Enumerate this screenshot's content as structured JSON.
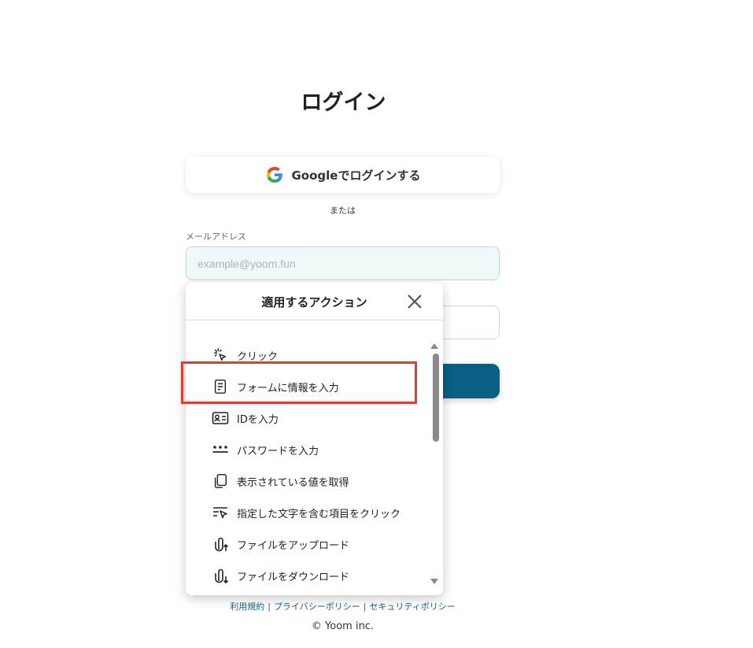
{
  "page": {
    "title": "ログイン",
    "google_button_label": "Googleでログインする",
    "or_text": "または",
    "email_label": "メールアドレス",
    "email_placeholder": "example@yoom.fun",
    "footer": {
      "terms": "利用規約",
      "privacy": "プライバシーポリシー",
      "security": "セキュリティポリシー",
      "separator": "|"
    },
    "copyright": "© Yoom inc."
  },
  "action_panel": {
    "title": "適用するアクション",
    "items": [
      {
        "label": "クリック",
        "icon": "click-cursor-icon"
      },
      {
        "label": "フォームに情報を入力",
        "icon": "form-document-icon",
        "highlighted": true
      },
      {
        "label": "IDを入力",
        "icon": "id-card-icon"
      },
      {
        "label": "パスワードを入力",
        "icon": "password-dots-icon"
      },
      {
        "label": "表示されている値を取得",
        "icon": "copy-icon"
      },
      {
        "label": "指定した文字を含む項目をクリック",
        "icon": "text-click-icon"
      },
      {
        "label": "ファイルをアップロード",
        "icon": "paperclip-upload-icon"
      },
      {
        "label": "ファイルをダウンロード",
        "icon": "paperclip-download-icon"
      }
    ]
  },
  "colors": {
    "primary_button": "#0c5f84",
    "highlight_border": "#e8392f",
    "email_field_bg": "#eef9fa",
    "link": "#1f5f85"
  }
}
